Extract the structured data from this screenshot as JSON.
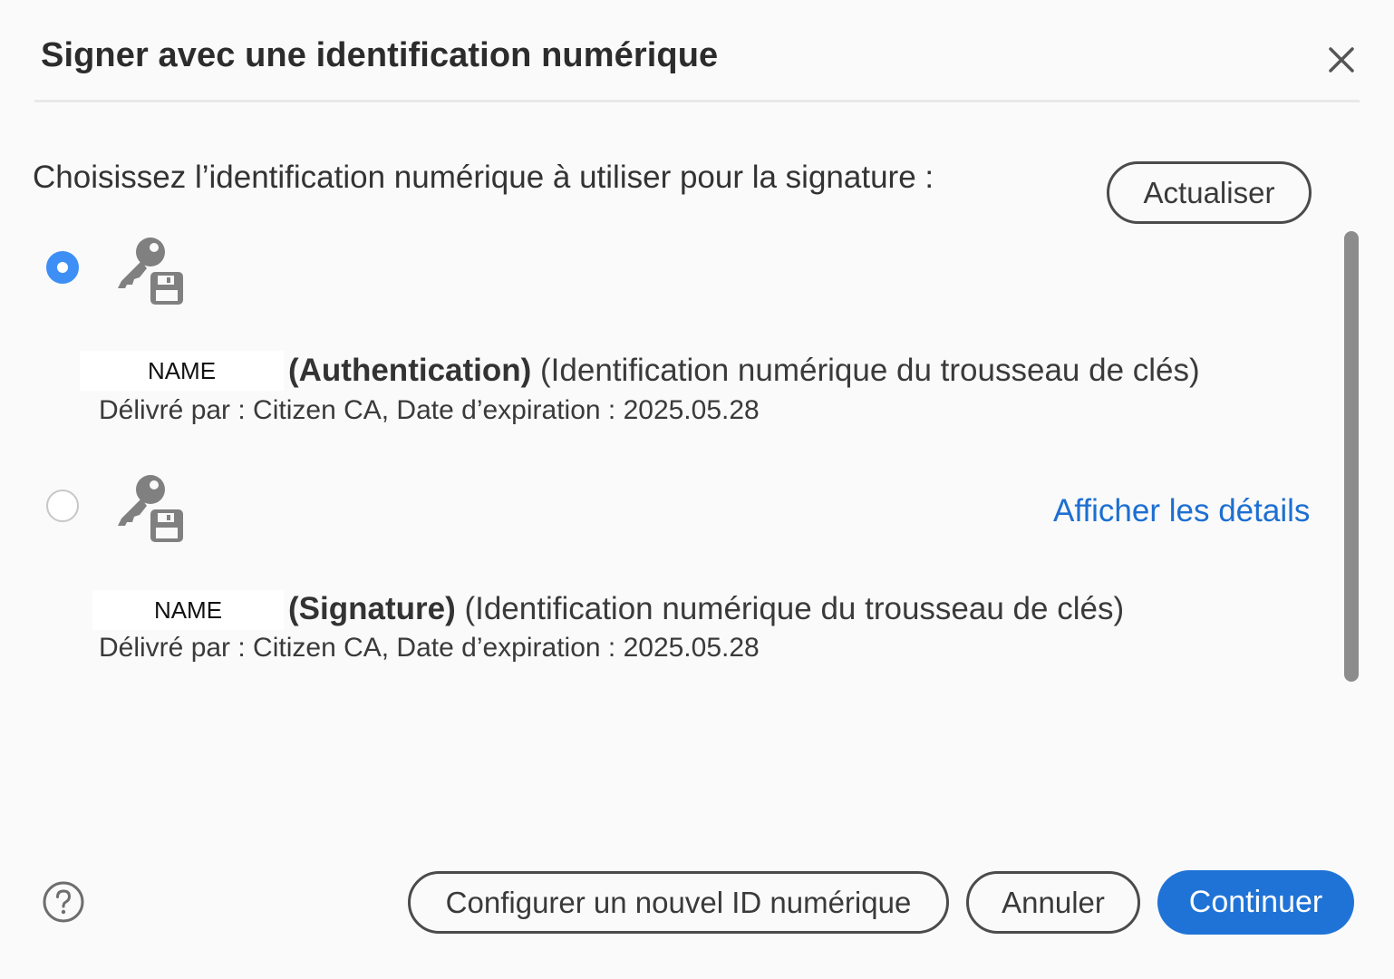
{
  "dialog": {
    "title": "Signer avec une identification numérique",
    "prompt": "Choisissez l’identification numérique à utiliser pour la signature :",
    "refresh_label": "Actualiser"
  },
  "ids": [
    {
      "selected": true,
      "name": "NAME",
      "type": "(Authentication)",
      "source": " (Identification numérique du trousseau de clés)",
      "issuer": "Délivré par : Citizen CA, Date d’expiration : 2025.05.28"
    },
    {
      "selected": false,
      "name": "NAME",
      "type": "(Signature)",
      "source": " (Identification numérique du trousseau de clés)",
      "issuer": "Délivré par : Citizen CA, Date d’expiration : 2025.05.28",
      "details_link": "Afficher les détails"
    }
  ],
  "footer": {
    "configure_label": "Configurer un nouvel ID numérique",
    "cancel_label": "Annuler",
    "continue_label": "Continuer"
  },
  "colors": {
    "accent": "#1f73d6",
    "radio_selected": "#3d8ff6",
    "link": "#1d6fd1"
  },
  "icons": {
    "close": "close-icon",
    "id": "key-floppy-icon",
    "help": "help-circle-icon"
  }
}
